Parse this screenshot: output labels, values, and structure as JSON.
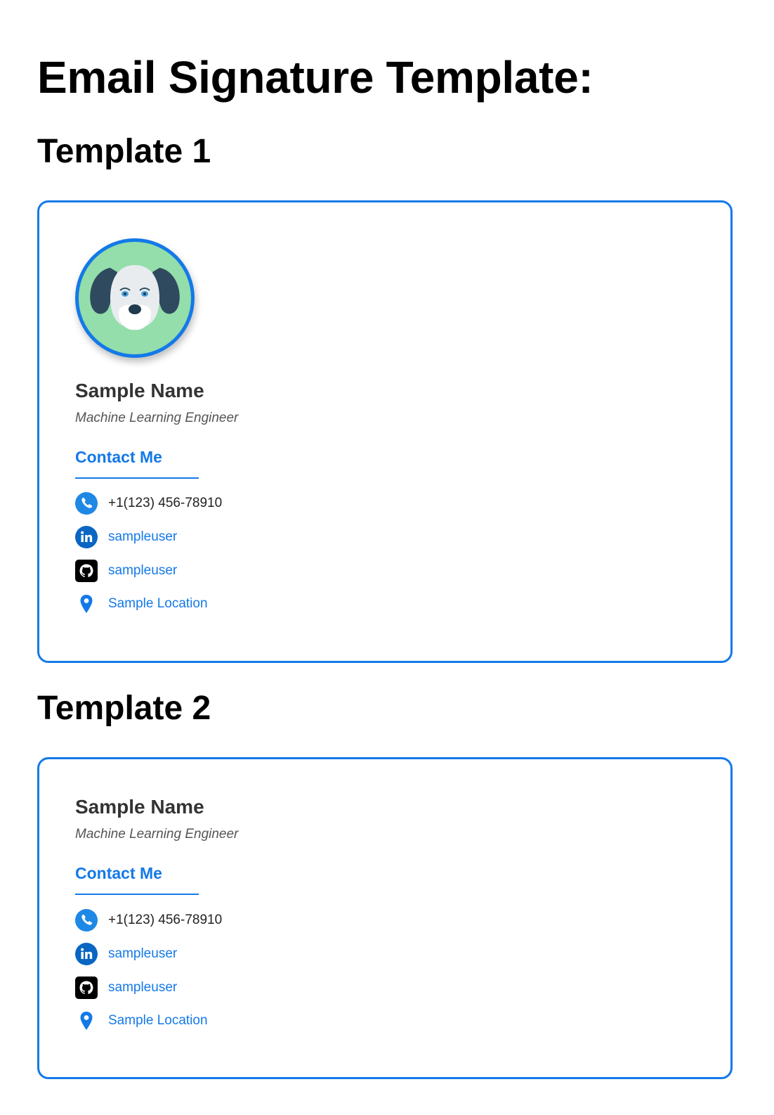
{
  "page": {
    "title": "Email Signature Template:"
  },
  "colors": {
    "accent": "#1479e8",
    "avatar_bg": "#93deab",
    "name_text": "#333333",
    "job_text": "#555555"
  },
  "templates": [
    {
      "heading": "Template 1",
      "has_avatar": true,
      "avatar_icon": "dog-avatar-icon",
      "name": "Sample Name",
      "job_title": "Machine Learning Engineer",
      "contact_heading": "Contact Me",
      "contacts": [
        {
          "icon": "phone-icon",
          "text": "+1(123) 456-78910",
          "link": false
        },
        {
          "icon": "linkedin-icon",
          "text": "sampleuser",
          "link": true
        },
        {
          "icon": "github-icon",
          "text": "sampleuser",
          "link": true
        },
        {
          "icon": "location-pin-icon",
          "text": "Sample Location",
          "link": true
        }
      ]
    },
    {
      "heading": "Template 2",
      "has_avatar": false,
      "name": "Sample Name",
      "job_title": "Machine Learning Engineer",
      "contact_heading": "Contact Me",
      "contacts": [
        {
          "icon": "phone-icon",
          "text": "+1(123) 456-78910",
          "link": false
        },
        {
          "icon": "linkedin-icon",
          "text": "sampleuser",
          "link": true
        },
        {
          "icon": "github-icon",
          "text": "sampleuser",
          "link": true
        },
        {
          "icon": "location-pin-icon",
          "text": "Sample Location",
          "link": true
        }
      ]
    }
  ]
}
